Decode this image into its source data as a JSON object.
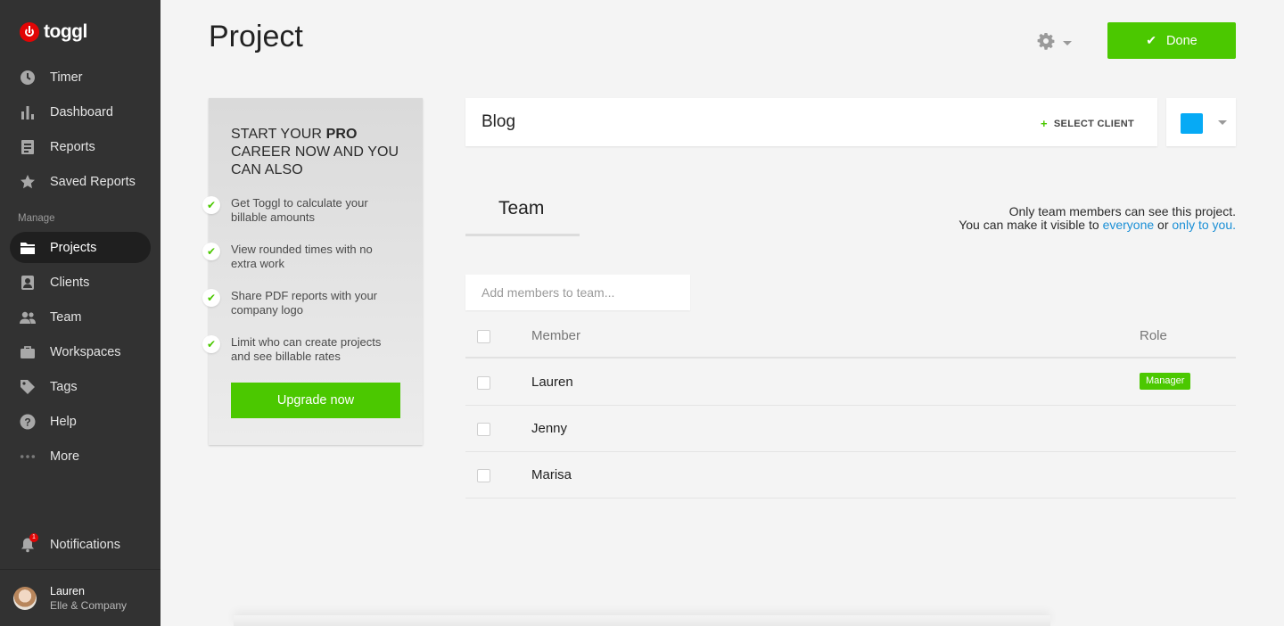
{
  "app": {
    "logo_text": "toggl"
  },
  "sidebar": {
    "items": [
      {
        "label": "Timer",
        "icon": "clock-icon"
      },
      {
        "label": "Dashboard",
        "icon": "bar-chart-icon"
      },
      {
        "label": "Reports",
        "icon": "document-icon"
      },
      {
        "label": "Saved Reports",
        "icon": "star-icon"
      }
    ],
    "section_label": "Manage",
    "manage_items": [
      {
        "label": "Projects",
        "icon": "folder-icon",
        "active": true
      },
      {
        "label": "Clients",
        "icon": "contact-icon"
      },
      {
        "label": "Team",
        "icon": "people-icon"
      },
      {
        "label": "Workspaces",
        "icon": "briefcase-icon"
      },
      {
        "label": "Tags",
        "icon": "tag-icon"
      },
      {
        "label": "Help",
        "icon": "help-icon"
      },
      {
        "label": "More",
        "icon": "ellipsis-icon"
      }
    ],
    "notifications": {
      "label": "Notifications",
      "count": "1"
    },
    "user": {
      "name": "Lauren",
      "company": "Elle & Company"
    }
  },
  "header": {
    "title": "Project",
    "done_label": "Done"
  },
  "promo": {
    "title_part1": "START YOUR ",
    "title_bold": "PRO",
    "title_part2": " CAREER NOW AND YOU CAN ALSO",
    "benefits": [
      "Get Toggl to calculate your billable amounts",
      "View rounded times with no extra work",
      "Share PDF reports with your company logo",
      "Limit who can create projects and see billable rates"
    ],
    "cta": "Upgrade now"
  },
  "project": {
    "name": "Blog",
    "select_client": "SELECT CLIENT",
    "color": "#06aaf5"
  },
  "team": {
    "tab_label": "Team",
    "visibility_line1": "Only team members can see this project.",
    "visibility_prefix": "You can make it visible to ",
    "visibility_link1": "everyone",
    "visibility_or": " or ",
    "visibility_link2": "only to you.",
    "add_placeholder": "Add members to team...",
    "columns": {
      "member": "Member",
      "role": "Role"
    },
    "members": [
      {
        "name": "Lauren",
        "role": "Manager"
      },
      {
        "name": "Jenny",
        "role": ""
      },
      {
        "name": "Marisa",
        "role": ""
      }
    ]
  },
  "colors": {
    "accent": "#4bc800",
    "sidebar_bg": "#323232",
    "link": "#1a8fd6",
    "logo_red": "#e20505"
  }
}
